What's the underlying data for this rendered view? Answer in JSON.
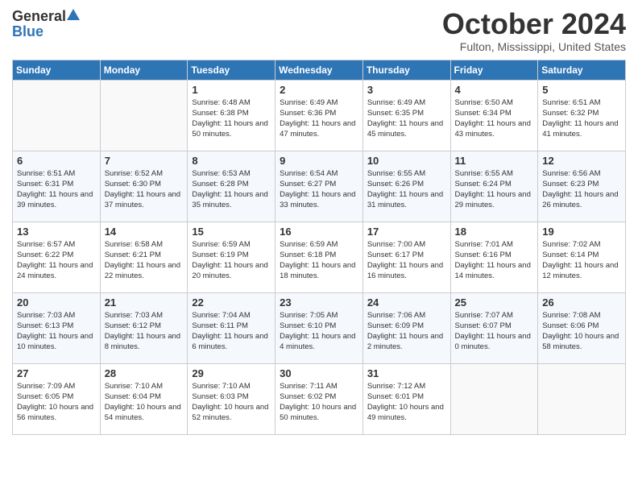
{
  "header": {
    "logo_general": "General",
    "logo_blue": "Blue",
    "month_title": "October 2024",
    "location": "Fulton, Mississippi, United States"
  },
  "weekdays": [
    "Sunday",
    "Monday",
    "Tuesday",
    "Wednesday",
    "Thursday",
    "Friday",
    "Saturday"
  ],
  "weeks": [
    [
      {
        "day": "",
        "info": ""
      },
      {
        "day": "",
        "info": ""
      },
      {
        "day": "1",
        "info": "Sunrise: 6:48 AM\nSunset: 6:38 PM\nDaylight: 11 hours and 50 minutes."
      },
      {
        "day": "2",
        "info": "Sunrise: 6:49 AM\nSunset: 6:36 PM\nDaylight: 11 hours and 47 minutes."
      },
      {
        "day": "3",
        "info": "Sunrise: 6:49 AM\nSunset: 6:35 PM\nDaylight: 11 hours and 45 minutes."
      },
      {
        "day": "4",
        "info": "Sunrise: 6:50 AM\nSunset: 6:34 PM\nDaylight: 11 hours and 43 minutes."
      },
      {
        "day": "5",
        "info": "Sunrise: 6:51 AM\nSunset: 6:32 PM\nDaylight: 11 hours and 41 minutes."
      }
    ],
    [
      {
        "day": "6",
        "info": "Sunrise: 6:51 AM\nSunset: 6:31 PM\nDaylight: 11 hours and 39 minutes."
      },
      {
        "day": "7",
        "info": "Sunrise: 6:52 AM\nSunset: 6:30 PM\nDaylight: 11 hours and 37 minutes."
      },
      {
        "day": "8",
        "info": "Sunrise: 6:53 AM\nSunset: 6:28 PM\nDaylight: 11 hours and 35 minutes."
      },
      {
        "day": "9",
        "info": "Sunrise: 6:54 AM\nSunset: 6:27 PM\nDaylight: 11 hours and 33 minutes."
      },
      {
        "day": "10",
        "info": "Sunrise: 6:55 AM\nSunset: 6:26 PM\nDaylight: 11 hours and 31 minutes."
      },
      {
        "day": "11",
        "info": "Sunrise: 6:55 AM\nSunset: 6:24 PM\nDaylight: 11 hours and 29 minutes."
      },
      {
        "day": "12",
        "info": "Sunrise: 6:56 AM\nSunset: 6:23 PM\nDaylight: 11 hours and 26 minutes."
      }
    ],
    [
      {
        "day": "13",
        "info": "Sunrise: 6:57 AM\nSunset: 6:22 PM\nDaylight: 11 hours and 24 minutes."
      },
      {
        "day": "14",
        "info": "Sunrise: 6:58 AM\nSunset: 6:21 PM\nDaylight: 11 hours and 22 minutes."
      },
      {
        "day": "15",
        "info": "Sunrise: 6:59 AM\nSunset: 6:19 PM\nDaylight: 11 hours and 20 minutes."
      },
      {
        "day": "16",
        "info": "Sunrise: 6:59 AM\nSunset: 6:18 PM\nDaylight: 11 hours and 18 minutes."
      },
      {
        "day": "17",
        "info": "Sunrise: 7:00 AM\nSunset: 6:17 PM\nDaylight: 11 hours and 16 minutes."
      },
      {
        "day": "18",
        "info": "Sunrise: 7:01 AM\nSunset: 6:16 PM\nDaylight: 11 hours and 14 minutes."
      },
      {
        "day": "19",
        "info": "Sunrise: 7:02 AM\nSunset: 6:14 PM\nDaylight: 11 hours and 12 minutes."
      }
    ],
    [
      {
        "day": "20",
        "info": "Sunrise: 7:03 AM\nSunset: 6:13 PM\nDaylight: 11 hours and 10 minutes."
      },
      {
        "day": "21",
        "info": "Sunrise: 7:03 AM\nSunset: 6:12 PM\nDaylight: 11 hours and 8 minutes."
      },
      {
        "day": "22",
        "info": "Sunrise: 7:04 AM\nSunset: 6:11 PM\nDaylight: 11 hours and 6 minutes."
      },
      {
        "day": "23",
        "info": "Sunrise: 7:05 AM\nSunset: 6:10 PM\nDaylight: 11 hours and 4 minutes."
      },
      {
        "day": "24",
        "info": "Sunrise: 7:06 AM\nSunset: 6:09 PM\nDaylight: 11 hours and 2 minutes."
      },
      {
        "day": "25",
        "info": "Sunrise: 7:07 AM\nSunset: 6:07 PM\nDaylight: 11 hours and 0 minutes."
      },
      {
        "day": "26",
        "info": "Sunrise: 7:08 AM\nSunset: 6:06 PM\nDaylight: 10 hours and 58 minutes."
      }
    ],
    [
      {
        "day": "27",
        "info": "Sunrise: 7:09 AM\nSunset: 6:05 PM\nDaylight: 10 hours and 56 minutes."
      },
      {
        "day": "28",
        "info": "Sunrise: 7:10 AM\nSunset: 6:04 PM\nDaylight: 10 hours and 54 minutes."
      },
      {
        "day": "29",
        "info": "Sunrise: 7:10 AM\nSunset: 6:03 PM\nDaylight: 10 hours and 52 minutes."
      },
      {
        "day": "30",
        "info": "Sunrise: 7:11 AM\nSunset: 6:02 PM\nDaylight: 10 hours and 50 minutes."
      },
      {
        "day": "31",
        "info": "Sunrise: 7:12 AM\nSunset: 6:01 PM\nDaylight: 10 hours and 49 minutes."
      },
      {
        "day": "",
        "info": ""
      },
      {
        "day": "",
        "info": ""
      }
    ]
  ]
}
